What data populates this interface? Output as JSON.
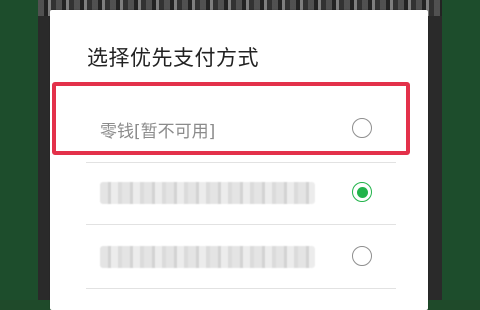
{
  "dialog": {
    "title": "选择优先支付方式",
    "options": [
      {
        "label": "零钱[暂不可用]",
        "state": "unavailable",
        "selected": false
      },
      {
        "label": "",
        "state": "obscured",
        "selected": true
      },
      {
        "label": "",
        "state": "obscured",
        "selected": false
      }
    ]
  },
  "colors": {
    "accent_selected": "#22b34b",
    "highlight_box": "#e3314a",
    "backdrop": "#1d4d2c"
  }
}
